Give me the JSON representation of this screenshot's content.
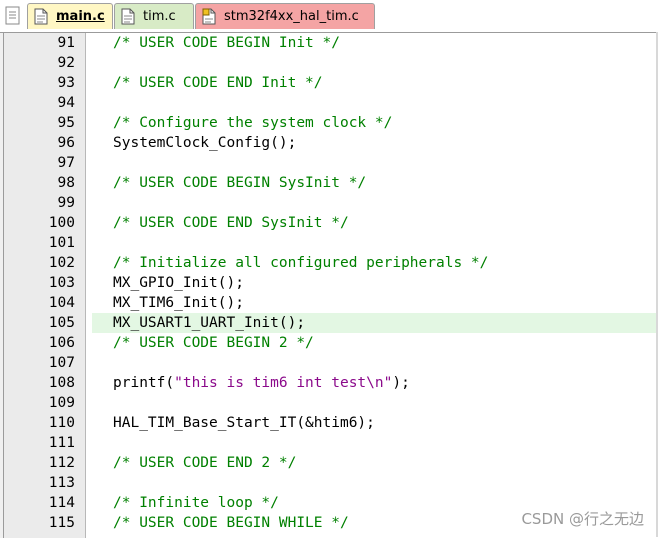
{
  "tabs": [
    {
      "label": "main.c",
      "active": true,
      "color": "#fff7c4"
    },
    {
      "label": "tim.c",
      "active": false,
      "color": "#d8ebc6"
    },
    {
      "label": "stm32f4xx_hal_tim.c",
      "active": false,
      "color": "#f4a4a4"
    }
  ],
  "highlight_line": 105,
  "lines": [
    {
      "n": "91",
      "parts": [
        {
          "t": "/* USER CODE BEGIN Init */",
          "c": "cm"
        }
      ]
    },
    {
      "n": "92",
      "parts": []
    },
    {
      "n": "93",
      "parts": [
        {
          "t": "/* USER CODE END Init */",
          "c": "cm"
        }
      ]
    },
    {
      "n": "94",
      "parts": []
    },
    {
      "n": "95",
      "parts": [
        {
          "t": "/* Configure the system clock */",
          "c": "cm"
        }
      ]
    },
    {
      "n": "96",
      "parts": [
        {
          "t": "SystemClock_Config();",
          "c": ""
        }
      ]
    },
    {
      "n": "97",
      "parts": []
    },
    {
      "n": "98",
      "parts": [
        {
          "t": "/* USER CODE BEGIN SysInit */",
          "c": "cm"
        }
      ]
    },
    {
      "n": "99",
      "parts": []
    },
    {
      "n": "100",
      "parts": [
        {
          "t": "/* USER CODE END SysInit */",
          "c": "cm"
        }
      ]
    },
    {
      "n": "101",
      "parts": []
    },
    {
      "n": "102",
      "parts": [
        {
          "t": "/* Initialize all configured peripherals */",
          "c": "cm"
        }
      ]
    },
    {
      "n": "103",
      "parts": [
        {
          "t": "MX_GPIO_Init();",
          "c": ""
        }
      ]
    },
    {
      "n": "104",
      "parts": [
        {
          "t": "MX_TIM6_Init();",
          "c": ""
        }
      ]
    },
    {
      "n": "105",
      "parts": [
        {
          "t": "MX_USART1_UART_Init();",
          "c": ""
        }
      ]
    },
    {
      "n": "106",
      "parts": [
        {
          "t": "/* USER CODE BEGIN 2 */",
          "c": "cm"
        }
      ]
    },
    {
      "n": "107",
      "parts": []
    },
    {
      "n": "108",
      "parts": [
        {
          "t": "printf(",
          "c": ""
        },
        {
          "t": "\"this is tim6 int test\\n\"",
          "c": "str"
        },
        {
          "t": ");",
          "c": ""
        }
      ]
    },
    {
      "n": "109",
      "parts": []
    },
    {
      "n": "110",
      "parts": [
        {
          "t": "HAL_TIM_Base_Start_IT(&htim6);",
          "c": ""
        }
      ]
    },
    {
      "n": "111",
      "parts": []
    },
    {
      "n": "112",
      "parts": [
        {
          "t": "/* USER CODE END 2 */",
          "c": "cm"
        }
      ]
    },
    {
      "n": "113",
      "parts": []
    },
    {
      "n": "114",
      "parts": [
        {
          "t": "/* Infinite loop */",
          "c": "cm"
        }
      ]
    },
    {
      "n": "115",
      "parts": [
        {
          "t": "/* USER CODE BEGIN WHILE */",
          "c": "cm"
        }
      ]
    }
  ],
  "watermark": "CSDN @行之无边"
}
